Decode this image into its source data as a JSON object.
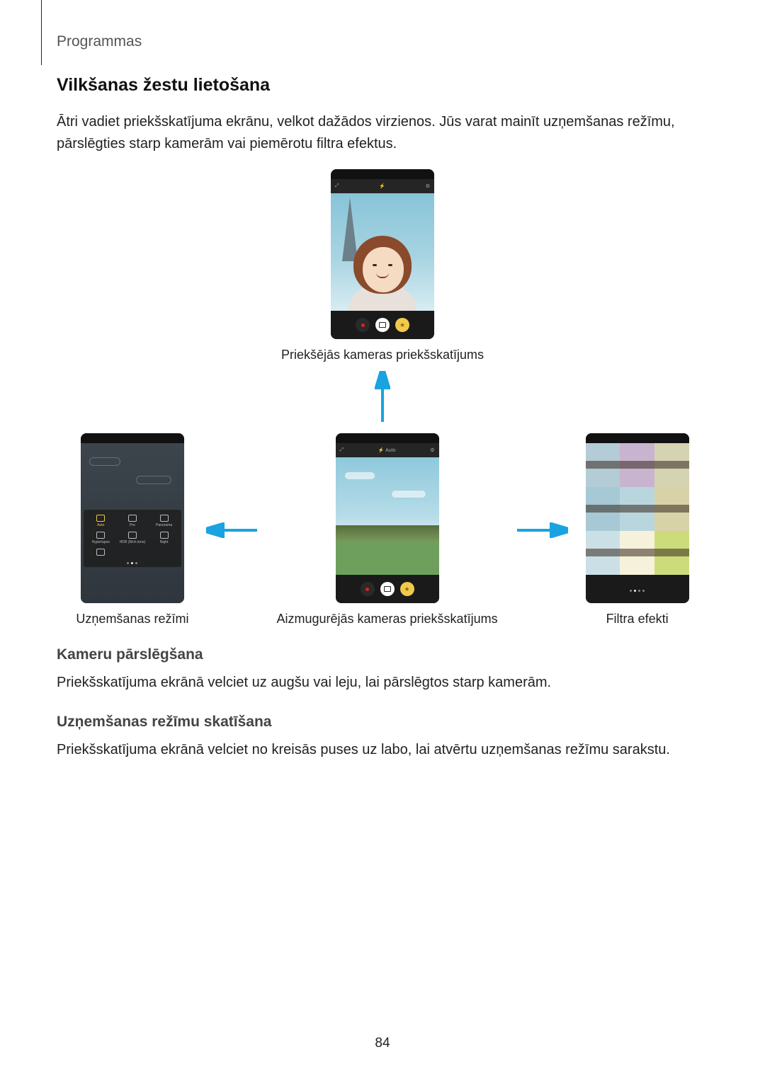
{
  "header": {
    "breadcrumb": "Programmas"
  },
  "section": {
    "title": "Vilkšanas žestu lietošana",
    "intro": "Ātri vadiet priekšskatījuma ekrānu, velkot dažādos virzienos. Jūs varat mainīt uzņemšanas režīmu, pārslēgties starp kamerām vai piemērotu filtra efektus."
  },
  "captions": {
    "front": "Priekšējās kameras priekšskatījums",
    "modes": "Uzņemšanas režīmi",
    "rear": "Aizmugurējās kameras priekšskatījums",
    "filters": "Filtra efekti"
  },
  "sub1": {
    "title": "Kameru pārslēgšana",
    "body": "Priekšskatījuma ekrānā velciet uz augšu vai leju, lai pārslēgtos starp kamerām."
  },
  "sub2": {
    "title": "Uzņemšanas režīmu skatīšana",
    "body": "Priekšskatījuma ekrānā velciet no kreisās puses uz labo, lai atvērtu uzņemšanas režīmu sarakstu."
  },
  "page_number": "84",
  "modes_grid": {
    "row1": [
      "Auto",
      "Pro",
      "Panorama"
    ],
    "row2": [
      "Hyperlapse",
      "HDR (Rich tone)",
      "Night"
    ],
    "row3": [
      "",
      ""
    ]
  }
}
